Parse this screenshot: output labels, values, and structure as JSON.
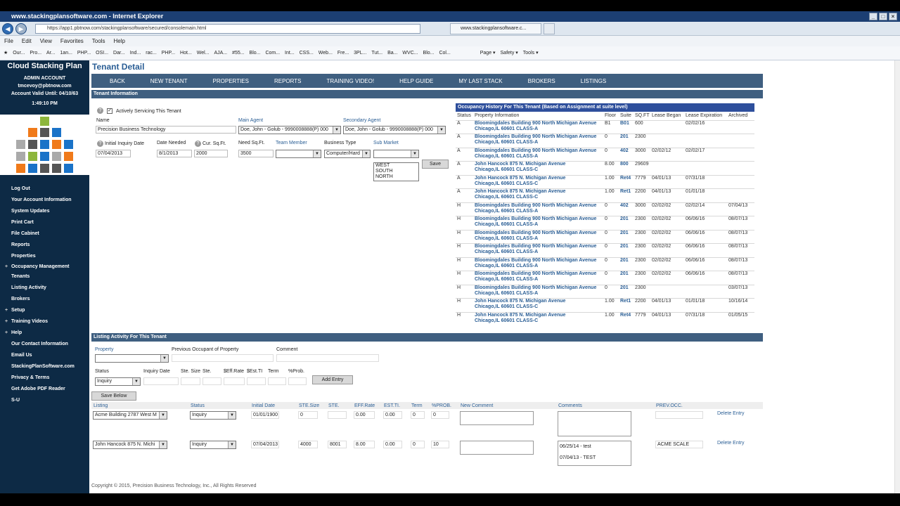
{
  "browser": {
    "title": "www.stackingplansoftware.com - Internet Explorer",
    "url": "https://app1.pbtnow.com/stackingplansoftware/secured/consolemain.html",
    "tab_label": "www.stackingplansoftware.c...",
    "menu": [
      "File",
      "Edit",
      "View",
      "Favorites",
      "Tools",
      "Help"
    ],
    "favorites": [
      "Our...",
      "Pro...",
      "Ar...",
      "1an...",
      "PHP...",
      "OSI...",
      "Dar...",
      "Ind...",
      "rac...",
      "PHP...",
      "Hot...",
      "Wel...",
      "AJA...",
      "#55...",
      "Blo...",
      "Com...",
      "Int...",
      "CSS...",
      "Web...",
      "Fre...",
      "3PL...",
      "Tut...",
      "Ba...",
      "WVC...",
      "Blo...",
      "Col..."
    ],
    "right_tools": [
      "Page ▾",
      "Safety ▾",
      "Tools ▾"
    ]
  },
  "sidebar": {
    "title": "Cloud Stacking Plan",
    "account_type": "ADMIN ACCOUNT",
    "email": "tmcevoy@pbtnow.com",
    "valid_until": "Account Valid Until: 04/10/63",
    "time": "1:49:10 PM",
    "links": [
      "Log Out",
      "Your Account Information",
      "System Updates",
      "Print Cart",
      "File Cabinet",
      "Reports",
      "Properties"
    ],
    "occupancy": "Occupancy Management",
    "sub_links": [
      "Tenants",
      "Listing Activity",
      "Brokers"
    ],
    "group_links": [
      "Setup",
      "Training Videos",
      "Help"
    ],
    "bottom_links": [
      "Our Contact Information",
      "Email Us",
      "StackingPlanSoftware.com",
      "Privacy & Terms",
      "Get Adobe PDF Reader",
      "S-U"
    ]
  },
  "page": {
    "title": "Tenant Detail",
    "nav": [
      "BACK",
      "NEW TENANT",
      "PROPERTIES",
      "REPORTS",
      "TRAINING VIDEO!",
      "HELP GUIDE",
      "MY LAST STACK",
      "BROKERS",
      "LISTINGS"
    ],
    "tenant_info_header": "Tenant Information",
    "actively_servicing": "Actively Servicing This Tenant",
    "labels": {
      "name": "Name",
      "main_agent": "Main Agent",
      "secondary_agent": "Secondary Agent",
      "initial_inquiry": "Initial Inquiry Date",
      "date_needed": "Date Needed",
      "cur_sqft": "Cur. Sq.Ft.",
      "need_sqft": "Need Sq.Ft.",
      "team_member": "Team Member",
      "business_type": "Business Type",
      "sub_market": "Sub Market"
    },
    "values": {
      "name": "Precision Business Technology",
      "main_agent": "Doe, John - Golub - 9990008888(P) 000",
      "secondary_agent": "Doe, John - Golub - 9990008888(P) 000",
      "initial_inquiry": "07/04/2013",
      "date_needed": "8/1/2013",
      "cur_sqft": "2000",
      "need_sqft": "3500",
      "business_type": "Computer/Hard"
    },
    "sub_market_options": [
      "WEST",
      "SOUTH",
      "NORTH"
    ],
    "save_label": "Save"
  },
  "occupancy": {
    "header": "Occupancy History For This Tenant (Based on Assignment at suite level)",
    "columns": [
      "Status",
      "Property Information",
      "Floor",
      "Suite",
      "SQ.FT",
      "Lease Began",
      "Lease Expiration",
      "Archived"
    ],
    "rows": [
      {
        "status": "A",
        "prop": "Bloomingdales Building 900 North Michigan Avenue",
        "city": "Chicago,IL 60601 CLASS-A",
        "floor": "B1",
        "suite": "B01",
        "sqft": "600",
        "began": "",
        "exp": "02/02/16",
        "arch": ""
      },
      {
        "status": "A",
        "prop": "Bloomingdales Building 900 North Michigan Avenue",
        "city": "Chicago,IL 60601 CLASS-A",
        "floor": "0",
        "suite": "201",
        "sqft": "2300",
        "began": "",
        "exp": "",
        "arch": ""
      },
      {
        "status": "A",
        "prop": "Bloomingdales Building 900 North Michigan Avenue",
        "city": "Chicago,IL 60601 CLASS-A",
        "floor": "0",
        "suite": "402",
        "sqft": "3000",
        "began": "02/02/12",
        "exp": "02/02/17",
        "arch": ""
      },
      {
        "status": "A",
        "prop": "John Hancock 875 N. Michigan Avenue",
        "city": "Chicago,IL 60601 CLASS-C",
        "floor": "8.00",
        "suite": "800",
        "sqft": "29609",
        "began": "",
        "exp": "",
        "arch": ""
      },
      {
        "status": "A",
        "prop": "John Hancock 875 N. Michigan Avenue",
        "city": "Chicago,IL 60601 CLASS-C",
        "floor": "1.00",
        "suite": "Ret4",
        "sqft": "7779",
        "began": "04/01/13",
        "exp": "07/31/18",
        "arch": ""
      },
      {
        "status": "A",
        "prop": "John Hancock 875 N. Michigan Avenue",
        "city": "Chicago,IL 60601 CLASS-C",
        "floor": "1.00",
        "suite": "Ret1",
        "sqft": "2200",
        "began": "04/01/13",
        "exp": "01/01/18",
        "arch": ""
      },
      {
        "status": "H",
        "prop": "Bloomingdales Building 900 North Michigan Avenue",
        "city": "Chicago,IL 60601 CLASS-A",
        "floor": "0",
        "suite": "402",
        "sqft": "3000",
        "began": "02/02/02",
        "exp": "02/02/14",
        "arch": "07/04/13"
      },
      {
        "status": "H",
        "prop": "Bloomingdales Building 900 North Michigan Avenue",
        "city": "Chicago,IL 60601 CLASS-A",
        "floor": "0",
        "suite": "201",
        "sqft": "2300",
        "began": "02/02/02",
        "exp": "06/06/16",
        "arch": "08/07/13"
      },
      {
        "status": "H",
        "prop": "Bloomingdales Building 900 North Michigan Avenue",
        "city": "Chicago,IL 60601 CLASS-A",
        "floor": "0",
        "suite": "201",
        "sqft": "2300",
        "began": "02/02/02",
        "exp": "06/06/16",
        "arch": "08/07/13"
      },
      {
        "status": "H",
        "prop": "Bloomingdales Building 900 North Michigan Avenue",
        "city": "Chicago,IL 60601 CLASS-A",
        "floor": "0",
        "suite": "201",
        "sqft": "2300",
        "began": "02/02/02",
        "exp": "06/06/16",
        "arch": "08/07/13"
      },
      {
        "status": "H",
        "prop": "Bloomingdales Building 900 North Michigan Avenue",
        "city": "Chicago,IL 60601 CLASS-A",
        "floor": "0",
        "suite": "201",
        "sqft": "2300",
        "began": "02/02/02",
        "exp": "06/06/16",
        "arch": "08/07/13"
      },
      {
        "status": "H",
        "prop": "Bloomingdales Building 900 North Michigan Avenue",
        "city": "Chicago,IL 60601 CLASS-A",
        "floor": "0",
        "suite": "201",
        "sqft": "2300",
        "began": "02/02/02",
        "exp": "06/06/16",
        "arch": "08/07/13"
      },
      {
        "status": "H",
        "prop": "Bloomingdales Building 900 North Michigan Avenue",
        "city": "Chicago,IL 60601 CLASS-A",
        "floor": "0",
        "suite": "201",
        "sqft": "2300",
        "began": "",
        "exp": "",
        "arch": "03/07/13"
      },
      {
        "status": "H",
        "prop": "John Hancock 875 N. Michigan Avenue",
        "city": "Chicago,IL 60601 CLASS-C",
        "floor": "1.00",
        "suite": "Ret1",
        "sqft": "2200",
        "began": "04/01/13",
        "exp": "01/01/18",
        "arch": "10/16/14"
      },
      {
        "status": "H",
        "prop": "John Hancock 875 N. Michigan Avenue",
        "city": "Chicago,IL 60601 CLASS-C",
        "floor": "1.00",
        "suite": "Ret4",
        "sqft": "7779",
        "began": "04/01/13",
        "exp": "07/31/18",
        "arch": "01/05/15"
      }
    ]
  },
  "listing": {
    "header": "Listing Activity For This Tenant",
    "labels": {
      "property": "Property",
      "prev_occupant": "Previous Occupant of Property",
      "comment": "Comment",
      "status": "Status",
      "inquiry_date": "Inquiry Date",
      "ste_size": "Ste. Size",
      "ste": "Ste.",
      "eff_rate": "$Eff.Rate",
      "est_ti": "$Est.TI",
      "term": "Term",
      "prob": "%Prob."
    },
    "status_value": "Inquiry",
    "add_entry": "Add Entry",
    "save_below": "Save Below",
    "columns": [
      "Listing",
      "Status",
      "Initial Date",
      "STE.Size",
      "STE.",
      "EFF.Rate",
      "EST.TI.",
      "Term",
      "%PROB.",
      "New Comment",
      "Comments",
      "PREV.OCC."
    ],
    "rows": [
      {
        "listing": "Acme Building 2787 West M",
        "status": "Inquiry",
        "date": "01/01/1900",
        "size": "0",
        "ste": "",
        "eff": "0.00",
        "ti": "0.00",
        "term": "0",
        "prob": "0",
        "comments": [
          "",
          ""
        ],
        "prev": "",
        "delete": "Delete Entry"
      },
      {
        "listing": "John Hancock 875 N. Michi",
        "status": "Inquiry",
        "date": "07/04/2013",
        "size": "4000",
        "ste": "8001",
        "eff": "8.00",
        "ti": "0.00",
        "term": "0",
        "prob": "10",
        "comments": [
          "06/25/14 - test",
          "07/04/13 - TEST"
        ],
        "prev": "ACME SCALE",
        "delete": "Delete Entry"
      }
    ]
  },
  "footer": "Copyright © 2015, Precision Business Technology, Inc., All Rights Reserved"
}
